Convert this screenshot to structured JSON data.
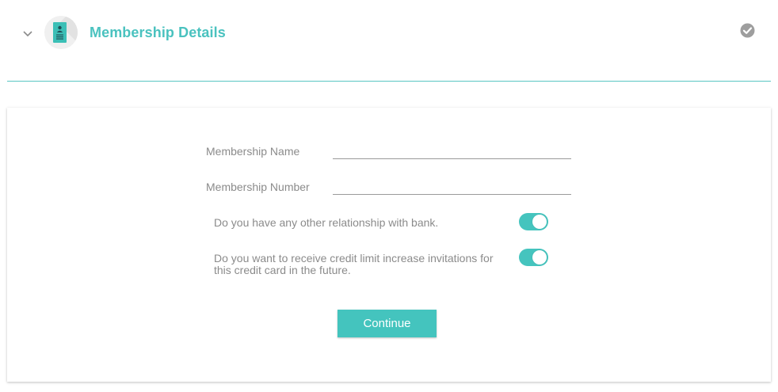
{
  "section": {
    "title": "Membership Details",
    "icons": {
      "collapse": "chevron-down-icon",
      "membership": "id-card-icon",
      "status": "check-circle-icon"
    }
  },
  "form": {
    "membership_name": {
      "label": "Membership Name",
      "value": ""
    },
    "membership_number": {
      "label": "Membership Number",
      "value": ""
    },
    "other_relationship": {
      "question": "Do you have any other relationship with bank.",
      "enabled": true
    },
    "credit_limit_invitations": {
      "question_line1": "Do you want to receive credit limit increase invitations for",
      "question_line2": "this credit card in the future.",
      "enabled": true
    },
    "continue_label": "Continue"
  },
  "colors": {
    "accent": "#4ac2bf",
    "toggle_on": "#45c4be",
    "label_text": "#8b8b8b",
    "check_icon": "#9e9e9e"
  }
}
